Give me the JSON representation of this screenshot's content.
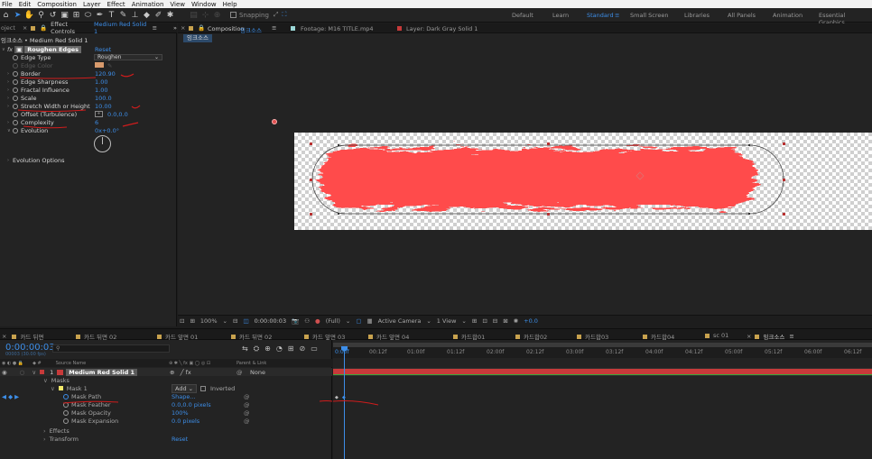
{
  "menu": [
    "File",
    "Edit",
    "Composition",
    "Layer",
    "Effect",
    "Animation",
    "View",
    "Window",
    "Help"
  ],
  "toolbar": {
    "snapping_label": "Snapping",
    "workspaces": [
      "Default",
      "Learn",
      "Standard",
      "Small Screen",
      "Libraries",
      "All Panels",
      "Animation",
      "Essential Graphics"
    ],
    "active_workspace": "Standard"
  },
  "effect_controls": {
    "project_tab": "oject",
    "tab_prefix": "Effect Controls",
    "tab_layer": "Medium Red Solid 1",
    "breadcrumb": "잉크소스 • Medium Red Solid 1",
    "effect_name": "Roughen Edges",
    "reset_label": "Reset",
    "props": [
      {
        "label": "Edge Type",
        "value": "Roughen"
      },
      {
        "label": "Edge Color",
        "value": ""
      },
      {
        "label": "Border",
        "value": "120.90"
      },
      {
        "label": "Edge Sharpness",
        "value": "1.00"
      },
      {
        "label": "Fractal Influence",
        "value": "1.00"
      },
      {
        "label": "Scale",
        "value": "100.0"
      },
      {
        "label": "Stretch Width or Height",
        "value": "10.00"
      },
      {
        "label": "Offset (Turbulence)",
        "value": "0.0,0.0"
      },
      {
        "label": "Complexity",
        "value": "6"
      },
      {
        "label": "Evolution",
        "value": "0x+0.0°"
      }
    ],
    "evolution_options": "Evolution Options"
  },
  "composition": {
    "tab_prefix": "Composition",
    "tab_name": "잉크소스",
    "footage_tab": "Footage: M16 TITLE.mp4",
    "layer_tab": "Layer: Dark Gray Solid 1",
    "sub_tab": "잉크소스",
    "bottom_bar": {
      "zoom": "100%",
      "timecode": "0:00:00:03",
      "resolution": "(Full)",
      "camera": "Active Camera",
      "view": "1 View",
      "exposure": "+0.0"
    }
  },
  "timeline": {
    "tabs": [
      "카드 뒤면",
      "카드 뒤면 02",
      "카드 앞면 01",
      "카드 뒤면 02",
      "카드 앞면 03",
      "카드 앞면 04",
      "카드합01",
      "카드합02",
      "카드합03",
      "카드합04",
      "sc 01",
      "잉크소스"
    ],
    "active_tab": "잉크소스",
    "timecode": "0:00:00:03",
    "fps": "00003 (30.00 fps)",
    "search_placeholder": "",
    "col_source": "Source Name",
    "col_parent": "Parent & Link",
    "layer_index": "1",
    "layer_name": "Medium Red Solid 1",
    "parent_value": "None",
    "masks_label": "Masks",
    "mask_name": "Mask 1",
    "mask_mode": "Add",
    "inverted_label": "Inverted",
    "mask_props": [
      {
        "label": "Mask Path",
        "value": "Shape..."
      },
      {
        "label": "Mask Feather",
        "value": "0.0,0.0 pixels"
      },
      {
        "label": "Mask Opacity",
        "value": "100%"
      },
      {
        "label": "Mask Expansion",
        "value": "0.0 pixels"
      }
    ],
    "effects_label": "Effects",
    "transform_label": "Transform",
    "transform_reset": "Reset",
    "ruler": [
      "0:00f",
      "00:12f",
      "01:00f",
      "01:12f",
      "02:00f",
      "02:12f",
      "03:00f",
      "03:12f",
      "04:00f",
      "04:12f",
      "05:00f",
      "05:12f",
      "06:00f",
      "06:12f"
    ]
  },
  "colors": {
    "accent": "#3d8ee8",
    "solid": "#ff4c4c",
    "annotation": "#d01c1c",
    "layer_bar": "#c73a3a"
  }
}
